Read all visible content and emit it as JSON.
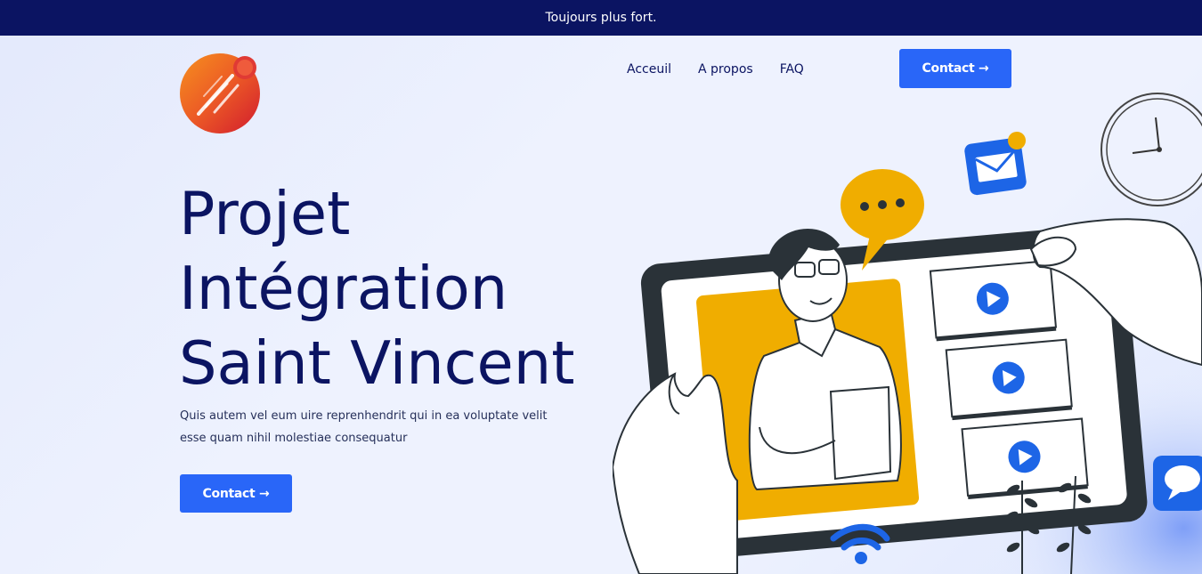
{
  "announcement": {
    "text": "Toujours plus fort."
  },
  "nav": {
    "items": [
      {
        "label": "Acceuil"
      },
      {
        "label": "A propos"
      },
      {
        "label": "FAQ"
      }
    ],
    "contact_button": "Contact →"
  },
  "hero": {
    "title_lines": [
      "Projet",
      "Intégration",
      "Saint Vincent"
    ],
    "description": "Quis autem vel eum uire reprenhendrit qui in ea voluptate velit esse quam nihil molestiae consequatur",
    "cta_label": "Contact →"
  },
  "colors": {
    "topbar": "#0b1462",
    "accent": "#2966f8",
    "title": "#0b1462",
    "illustration_yellow": "#f0ad00"
  },
  "icons": [
    "rocket-logo-icon",
    "clock-icon",
    "mail-icon",
    "speech-bubble-icon",
    "chat-icon",
    "wifi-icon",
    "play-icon",
    "plant-icon"
  ]
}
